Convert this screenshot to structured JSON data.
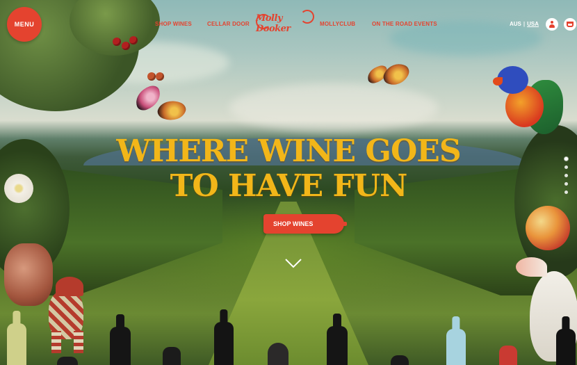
{
  "nav": {
    "menu_label": "MENU",
    "links": [
      "SHOP WINES",
      "CELLAR DOOR",
      "MOLLYCLUB",
      "ON THE ROAD EVENTS"
    ],
    "logo_text": "Molly Dooker",
    "region": {
      "current": "AUS",
      "separator": "|",
      "other": "USA"
    }
  },
  "hero": {
    "headline_line1": "WHERE WINE GOES",
    "headline_line2": "TO HAVE FUN",
    "cta_label": "SHOP WINES"
  },
  "slider": {
    "count": 5,
    "active": 0
  },
  "colors": {
    "brand_red": "#e4432f",
    "headline_yellow": "#f2b619"
  },
  "icons": [
    "menu",
    "user-icon",
    "cart-icon",
    "chevron-down-icon"
  ]
}
